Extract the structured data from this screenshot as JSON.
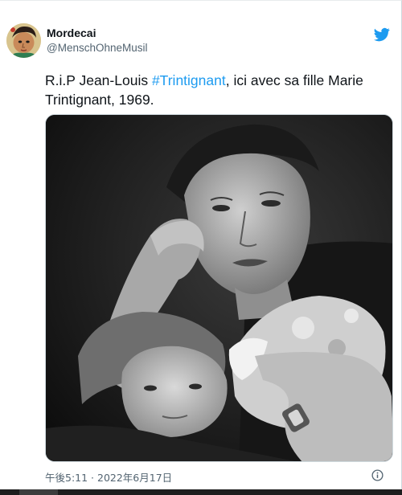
{
  "tweet": {
    "display_name": "Mordecai",
    "handle": "@MenschOhneMusil",
    "text_before": "R.i.P Jean-Louis ",
    "hashtag": "#Trintignant",
    "text_after": ", ici avec sa fille Marie Trintignant, 1969.",
    "timestamp": "午後5:11 · 2022年6月17日"
  },
  "icons": {
    "brand": "twitter-bird-icon",
    "info": "info-icon"
  },
  "colors": {
    "accent": "#1d9bf0",
    "secondary_text": "#536471",
    "primary_text": "#0f1419"
  }
}
